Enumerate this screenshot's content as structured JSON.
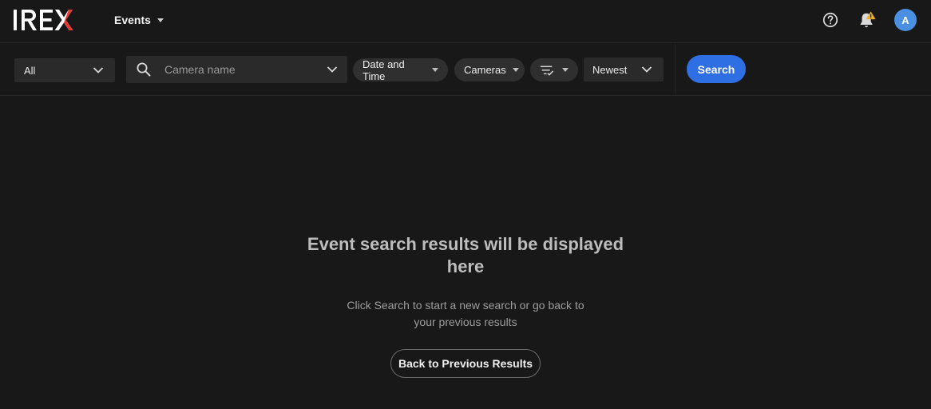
{
  "header": {
    "app_menu_label": "Events",
    "avatar_initial": "A"
  },
  "filters": {
    "type_select_value": "All",
    "search_placeholder": "Camera name",
    "date_time_label": "Date and Time",
    "cameras_label": "Cameras",
    "sort_value": "Newest",
    "search_button_label": "Search"
  },
  "empty_state": {
    "title": "Event search results will be displayed here",
    "subtitle": "Click Search to start a new search or go back to your previous results",
    "back_button_label": "Back to Previous Results"
  },
  "colors": {
    "background": "#181818",
    "primary": "#2f6fe4",
    "warning": "#f2b01e",
    "avatar": "#4a90e2"
  }
}
